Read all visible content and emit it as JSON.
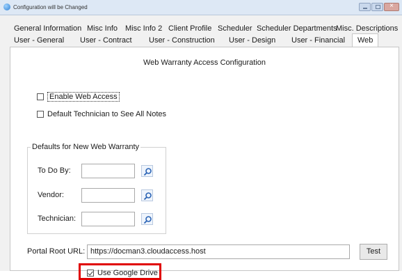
{
  "window": {
    "title": "Configuration will be Changed",
    "controls": [
      "minimize",
      "maximize",
      "close"
    ]
  },
  "tabs": {
    "row1": [
      "General Information",
      "Misc Info",
      "Misc Info 2",
      "Client Profile",
      "Scheduler",
      "Scheduler Departments",
      "Misc. Descriptions"
    ],
    "row2": [
      "User - General",
      "User - Contract",
      "User - Construction",
      "User - Design",
      "User - Financial",
      "Web"
    ],
    "active": "Web"
  },
  "web_panel": {
    "title": "Web Warranty Access Configuration",
    "enable_web_access": {
      "label": "Enable Web Access",
      "checked": false
    },
    "default_technician": {
      "label": "Default Technician to See All Notes",
      "checked": false
    },
    "defaults_group": {
      "legend": "Defaults for New Web Warranty",
      "to_do_by": {
        "label": "To Do By:",
        "value": ""
      },
      "vendor": {
        "label": "Vendor:",
        "value": ""
      },
      "technician": {
        "label": "Technician:",
        "value": ""
      },
      "lookup_icon": "magnifier-icon"
    },
    "portal_root": {
      "label": "Portal Root URL:",
      "value": "https://docman3.cloudaccess.host",
      "test_label": "Test"
    },
    "use_google_drive": {
      "label": "Use Google Drive",
      "checked": true
    },
    "highlight_color": "#e00000"
  }
}
